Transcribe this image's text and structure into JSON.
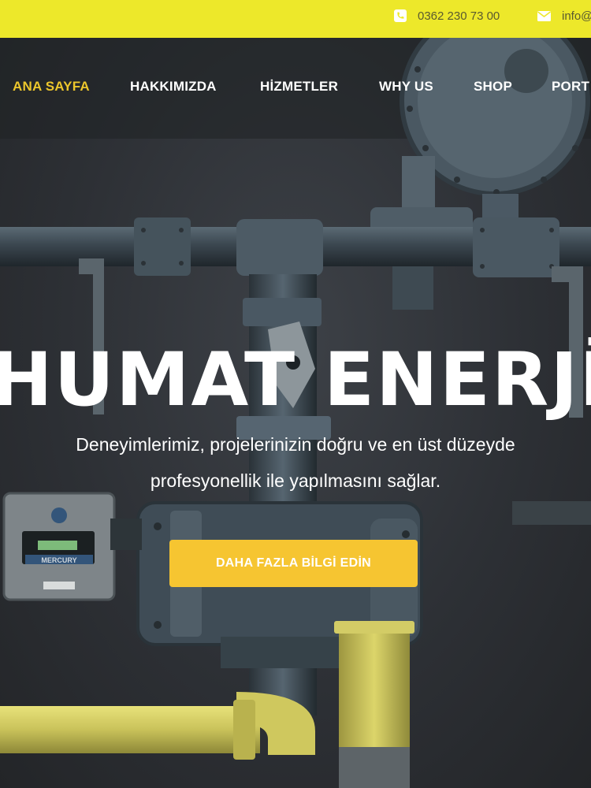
{
  "topbar": {
    "phone": "0362 230 73 00",
    "email": "info@",
    "phone_icon": "phone-square-icon",
    "email_icon": "envelope-icon"
  },
  "nav": {
    "items": [
      {
        "label": "ANA SAYFA",
        "active": true
      },
      {
        "label": "HAKKIMIZDA",
        "active": false
      },
      {
        "label": "HİZMETLER",
        "active": false
      },
      {
        "label": "WHY US",
        "active": false
      },
      {
        "label": "SHOP",
        "active": false
      },
      {
        "label": "PORT",
        "active": false
      }
    ]
  },
  "hero": {
    "title": "HUMAT ENERJİ",
    "subtitle_line1": "Deneyimlerimiz, projelerinizin doğru ve en üst düzeyde",
    "subtitle_line2": "profesyonellik ile yapılmasını sağlar.",
    "cta_label": "DAHA FAZLA BİLGİ EDİN"
  },
  "colors": {
    "topbar": "#ede82a",
    "accent": "#ecc62c",
    "button": "#f6c531",
    "wall": "#2d3035"
  }
}
